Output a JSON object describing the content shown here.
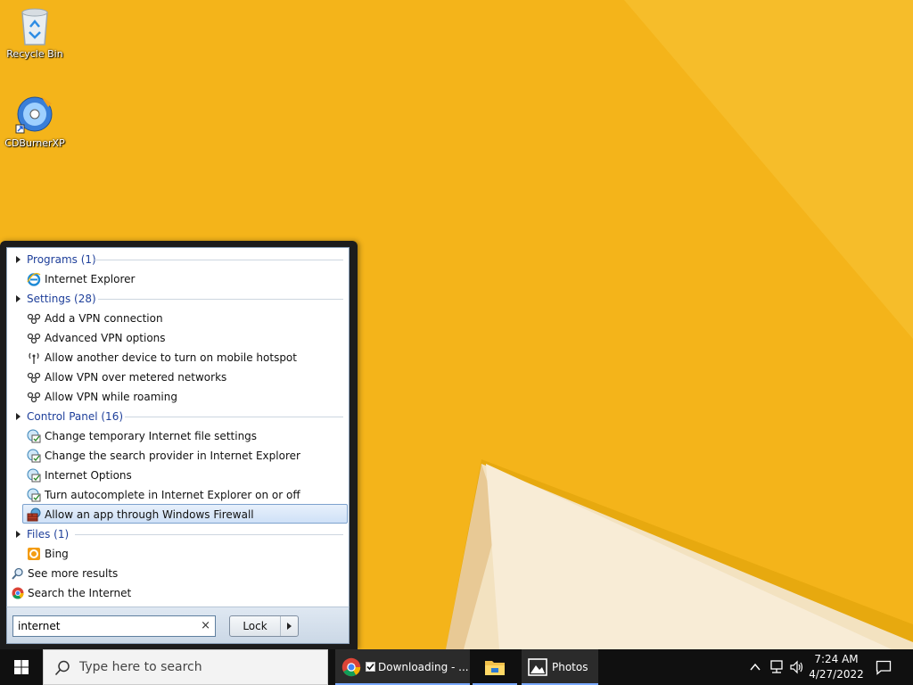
{
  "desktop": {
    "icons": [
      {
        "label": "Recycle Bin",
        "icon": "recycle-bin-icon"
      },
      {
        "label": "CDBurnerXP",
        "icon": "cd-burner-icon"
      }
    ],
    "wallpaper_color": "#f4b41a"
  },
  "start_menu": {
    "groups": {
      "programs": {
        "header": "Programs (1)",
        "items": [
          "Internet Explorer"
        ]
      },
      "settings": {
        "header": "Settings (28)",
        "items": [
          "Add a VPN connection",
          "Advanced VPN options",
          "Allow another device to turn on mobile hotspot",
          "Allow VPN over metered networks",
          "Allow VPN while roaming"
        ]
      },
      "control_panel": {
        "header": "Control Panel (16)",
        "items": [
          "Change temporary Internet file settings",
          "Change the search provider in Internet Explorer",
          "Internet Options",
          "Turn autocomplete in Internet Explorer on or off",
          "Allow an app through Windows Firewall"
        ],
        "selected_index": 4
      },
      "files": {
        "header": "Files (1)",
        "items": [
          "Bing"
        ]
      }
    },
    "footer": {
      "see_more": "See more results",
      "search_internet": "Search the Internet"
    },
    "search": {
      "value": "internet",
      "clear_glyph": "×"
    },
    "lock_button": {
      "label": "Lock"
    }
  },
  "taskbar": {
    "search_placeholder": "Type here to search",
    "apps": [
      {
        "label": "Downloading - ...",
        "icon": "chrome-icon"
      },
      {
        "label": "",
        "icon": "file-explorer-icon"
      },
      {
        "label": "Photos",
        "icon": "photos-icon"
      }
    ],
    "clock": {
      "time": "7:24 AM",
      "date": "4/27/2022"
    }
  }
}
